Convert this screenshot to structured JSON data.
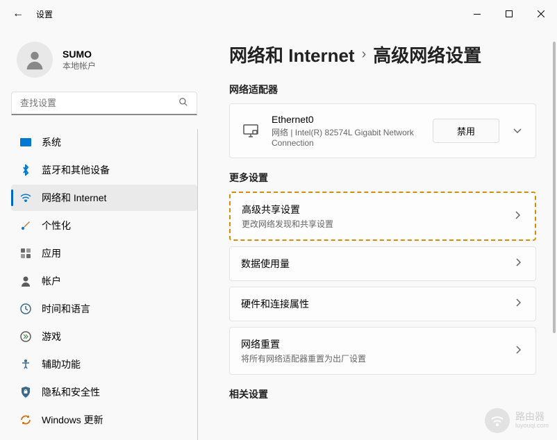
{
  "titlebar": {
    "title": "设置"
  },
  "user": {
    "name": "SUMO",
    "account_type": "本地帐户"
  },
  "search": {
    "placeholder": "查找设置"
  },
  "sidebar": {
    "items": [
      {
        "label": "系统"
      },
      {
        "label": "蓝牙和其他设备"
      },
      {
        "label": "网络和 Internet"
      },
      {
        "label": "个性化"
      },
      {
        "label": "应用"
      },
      {
        "label": "帐户"
      },
      {
        "label": "时间和语言"
      },
      {
        "label": "游戏"
      },
      {
        "label": "辅助功能"
      },
      {
        "label": "隐私和安全性"
      },
      {
        "label": "Windows 更新"
      }
    ]
  },
  "breadcrumb": {
    "parent": "网络和 Internet",
    "current": "高级网络设置"
  },
  "sections": {
    "adapters": {
      "title": "网络适配器",
      "ethernet": {
        "name": "Ethernet0",
        "desc": "网络 | Intel(R) 82574L Gigabit Network Connection",
        "disable_label": "禁用"
      }
    },
    "more": {
      "title": "更多设置",
      "sharing": {
        "title": "高级共享设置",
        "desc": "更改网络发现和共享设置"
      },
      "usage": {
        "title": "数据使用量"
      },
      "hardware": {
        "title": "硬件和连接属性"
      },
      "reset": {
        "title": "网络重置",
        "desc": "将所有网络适配器重置为出厂设置"
      }
    },
    "related": {
      "title": "相关设置"
    }
  },
  "watermark": {
    "text": "路由器",
    "url": "luyouqi.com"
  }
}
